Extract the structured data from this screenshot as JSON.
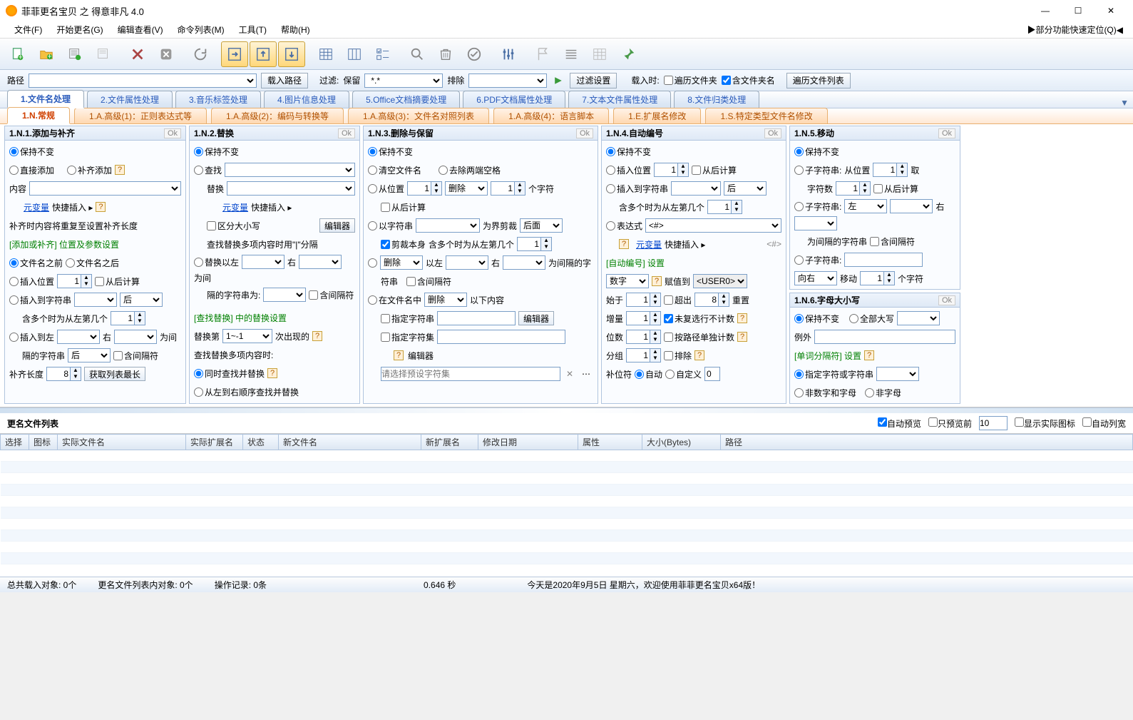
{
  "title": "菲菲更名宝贝 之 得意非凡 4.0",
  "menu": [
    "文件(F)",
    "开始更名(G)",
    "编辑查看(V)",
    "命令列表(M)",
    "工具(T)",
    "帮助(H)"
  ],
  "quick_locate": "▶部分功能快速定位(Q)◀",
  "pathbar": {
    "path_label": "路径",
    "load_path": "载入路径",
    "filter_label": "过滤:",
    "keep_label": "保留",
    "keep_val": "*.*",
    "exclude_label": "排除",
    "filter_settings": "过滤设置",
    "on_load": "载入时:",
    "traverse_folders": "遍历文件夹",
    "include_folder_names": "含文件夹名",
    "traverse_list": "遍历文件列表"
  },
  "tabs": [
    "1.文件名处理",
    "2.文件属性处理",
    "3.音乐标签处理",
    "4.图片信息处理",
    "5.Office文档摘要处理",
    "6.PDF文档属性处理",
    "7.文本文件属性处理",
    "8.文件归类处理"
  ],
  "subtabs": [
    "1.N.常规",
    "1.A.高级(1)：正则表达式等",
    "1.A.高级(2)：编码与转换等",
    "1.A.高级(3)：文件名对照列表",
    "1.A.高级(4)：语言脚本",
    "1.E.扩展名修改",
    "1.S.特定类型文件名修改"
  ],
  "p1": {
    "title": "1.N.1.添加与补齐",
    "keep": "保持不变",
    "direct_add": "直接添加",
    "pad_add": "补齐添加",
    "content": "内容",
    "meta_var": "元变量",
    "quick_insert": "快捷插入 ▸",
    "pad_note": "补齐时内容将重复至设置补齐长度",
    "section_pos": "[添加或补齐] 位置及参数设置",
    "before_name": "文件名之前",
    "after_name": "文件名之后",
    "insert_pos": "插入位置",
    "insert_to_str": "插入到字符串",
    "from_end": "从后计算",
    "after": "后",
    "multi_from_left": "含多个时为从左第几个",
    "insert_to_left": "插入到左",
    "right": "右",
    "between": "为间",
    "sep_str": "隔的字符串",
    "include_sep": "含间隔符",
    "pad_len": "补齐长度",
    "pad_len_val": "8",
    "get_longest": "获取列表最长"
  },
  "p2": {
    "title": "1.N.2.替换",
    "keep": "保持不变",
    "find": "查找",
    "replace": "替换",
    "meta_var": "元变量",
    "quick_insert": "快捷插入 ▸",
    "case_sens": "区分大小写",
    "editor": "编辑器",
    "multi_note": "查找替换多项内容时用\"|\"分隔",
    "replace_left": "替换以左",
    "right": "右",
    "between": "为间",
    "sep_for": "隔的字符串为:",
    "include_sep": "含间隔符",
    "section_find": "[查找替换] 中的替换设置",
    "replace_nth": "替换第",
    "nth_val": "1~-1",
    "occurrence": "次出现的",
    "when_multi": "查找替换多项内容时:",
    "simultaneous": "同时查找并替换",
    "sequential": "从左到右顺序查找并替换"
  },
  "p3": {
    "title": "1.N.3.删除与保留",
    "keep": "保持不变",
    "clear_filename": "清空文件名",
    "trim_spaces": "去除两端空格",
    "from_pos": "从位置",
    "delete": "删除",
    "chars": "个字符",
    "from_end": "从后计算",
    "by_str": "以字符串",
    "trim_by": "为界剪裁",
    "after": "后面",
    "trim_self": "剪裁本身",
    "multi_from_left": "含多个时为从左第几个",
    "delete_sel": "删除",
    "by_left": "以左",
    "right": "右",
    "between_chars": "为间隔的字",
    "str_suffix": "符串",
    "include_sep": "含间隔符",
    "in_filename": "在文件名中",
    "following": "以下内容",
    "spec_str": "指定字符串",
    "editor": "编辑器",
    "spec_set": "指定字符集",
    "preset": "请选择预设字符集"
  },
  "p4": {
    "title": "1.N.4.自动编号",
    "keep": "保持不变",
    "insert_pos": "插入位置",
    "from_end": "从后计算",
    "insert_to_str": "插入到字符串",
    "after": "后",
    "multi_from_left": "含多个时为从左第几个",
    "expression": "表达式",
    "expr_val": "<#>",
    "meta_var": "元变量",
    "quick_insert": "快捷插入 ▸",
    "expr_hint": "<#>",
    "section_auto": "[自动编号] 设置",
    "type_num": "数字",
    "assign_to": "赋值到",
    "user0": "<USER0>",
    "start": "始于",
    "exceed": "超出",
    "exceed_val": "8",
    "reset": "重置",
    "increment": "增量",
    "skip_unexec": "未复选行不计数",
    "digits": "位数",
    "per_path": "按路径单独计数",
    "group": "分组",
    "exclude": "排除",
    "pad_char": "补位符",
    "auto": "自动",
    "custom": "自定义",
    "custom_val": "0"
  },
  "p5": {
    "title": "1.N.5.移动",
    "keep": "保持不变",
    "substr": "子字符串:",
    "from_pos": "从位置",
    "take": "取",
    "char_count": "字符数",
    "from_end": "从后计算",
    "substr2": "子字符串:",
    "left": "左",
    "right": "右",
    "sep_str": "为间隔的字符串",
    "include_sep": "含间隔符",
    "substr3": "子字符串:",
    "move_right": "向右",
    "move": "移动",
    "chars": "个字符"
  },
  "p6": {
    "title": "1.N.6.字母大小写",
    "keep": "保持不变",
    "all_upper": "全部大写",
    "except": "例外",
    "section_sep": "[单词分隔符] 设置",
    "spec_char": "指定字符或字符串",
    "non_alnum": "非数字和字母",
    "non_alpha": "非字母"
  },
  "list": {
    "title": "更名文件列表",
    "auto_preview": "自动预览",
    "preview_only_first": "只预览前",
    "preview_count": "10",
    "show_real_icon": "显示实际图标",
    "auto_colwidth": "自动列宽",
    "cols": [
      "选择",
      "图标",
      "实际文件名",
      "实际扩展名",
      "状态",
      "新文件名",
      "新扩展名",
      "修改日期",
      "属性",
      "大小(Bytes)",
      "路径"
    ]
  },
  "status": {
    "loaded": "总共载入对象: 0个",
    "in_list": "更名文件列表内对象: 0个",
    "op_record": "操作记录: 0条",
    "time": "0.646 秒",
    "date": "今天是2020年9月5日 星期六，欢迎使用菲菲更名宝贝x64版！"
  },
  "ok": "Ok",
  "one": "1"
}
